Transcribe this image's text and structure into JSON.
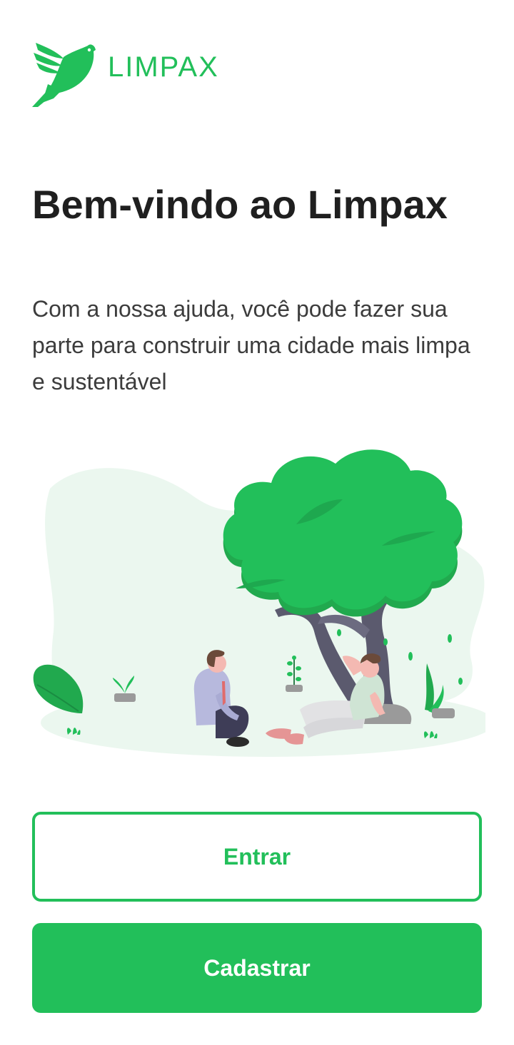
{
  "brand": {
    "name": "LIMPAX",
    "accent_color": "#22bf5a",
    "logo_icon": "bird-icon"
  },
  "welcome": {
    "title": "Bem-vindo ao Limpax",
    "subtitle": "Com a nossa ajuda, você pode fazer sua parte para construir uma cidade mais limpa e sustentável"
  },
  "illustration": {
    "icon": "people-under-tree-illustration"
  },
  "actions": {
    "login_label": "Entrar",
    "signup_label": "Cadastrar"
  }
}
